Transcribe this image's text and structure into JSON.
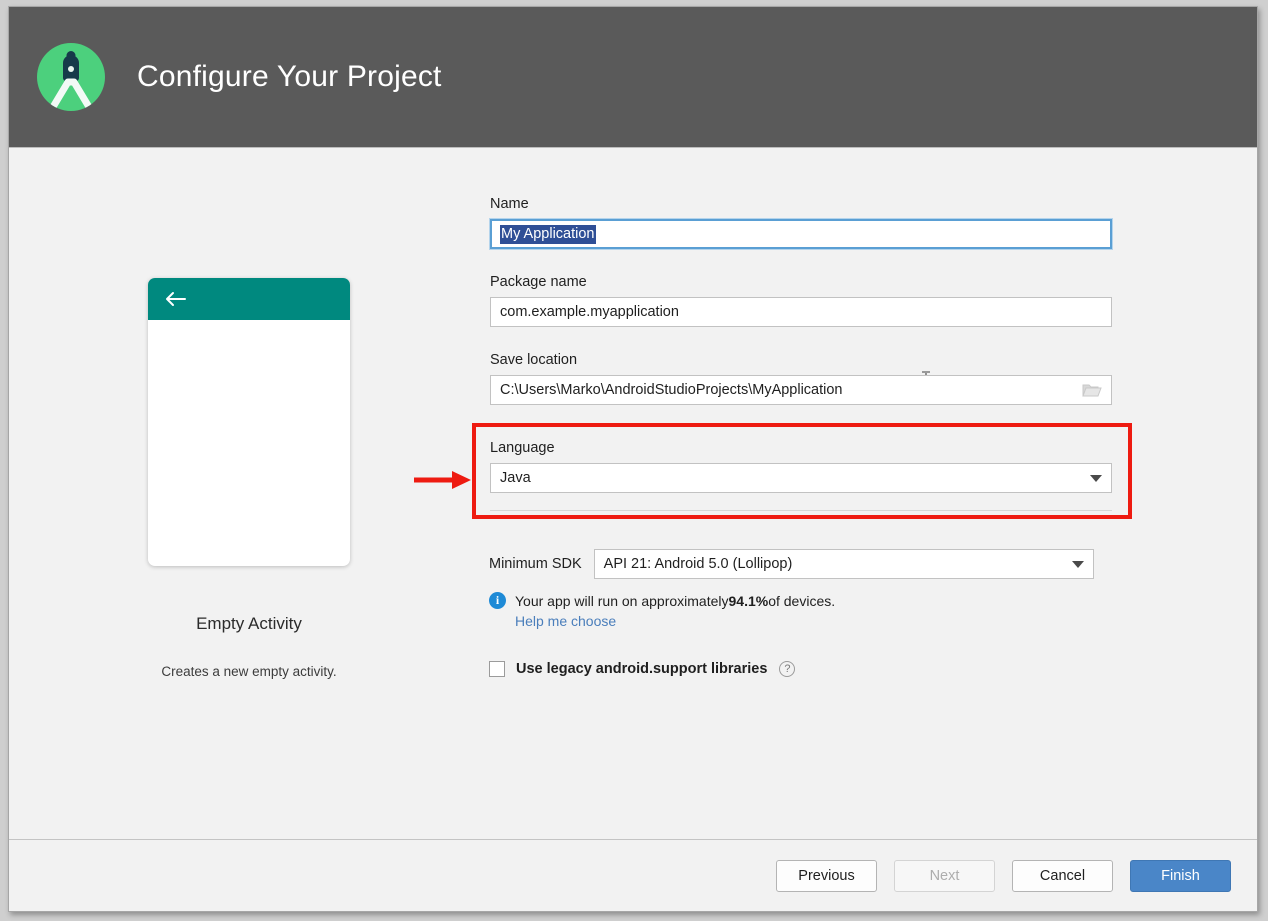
{
  "header": {
    "title": "Configure Your Project",
    "logo_icon": "android-studio-logo-icon"
  },
  "preview": {
    "back_icon": "back-arrow-icon",
    "template_title": "Empty Activity",
    "template_description": "Creates a new empty activity."
  },
  "form": {
    "name": {
      "label": "Name",
      "value": "My Application",
      "selected": true
    },
    "package_name": {
      "label": "Package name",
      "value": "com.example.myapplication"
    },
    "save_location": {
      "label": "Save location",
      "value": "C:\\Users\\Marko\\AndroidStudioProjects\\MyApplication",
      "browse_icon": "folder-open-icon"
    },
    "language": {
      "label": "Language",
      "value": "Java",
      "caret_icon": "chevron-down-icon",
      "highlighted": true
    },
    "minimum_sdk": {
      "label": "Minimum SDK",
      "value": "API 21: Android 5.0 (Lollipop)",
      "caret_icon": "chevron-down-icon"
    },
    "device_info": {
      "info_icon": "info-icon",
      "text_before": "Your app will run on approximately ",
      "percent": "94.1%",
      "text_after": " of devices.",
      "help_link": "Help me choose"
    },
    "legacy_libraries": {
      "label": "Use legacy android.support libraries",
      "checked": false,
      "help_icon": "question-mark-icon"
    }
  },
  "footer": {
    "previous": "Previous",
    "next": "Next",
    "cancel": "Cancel",
    "finish": "Finish"
  },
  "annotations": {
    "highlight_color": "#ee1b11",
    "arrow_icon": "red-arrow-icon",
    "cursor_icon": "text-ibeam-cursor-icon"
  },
  "colors": {
    "header_bg": "#5a5a5a",
    "logo_green": "#4cd07d",
    "appbar_teal": "#00897f",
    "primary_button": "#4a86c8",
    "link": "#4a7ebb",
    "selection": "#2f4f96",
    "annotation_red": "#ee1b11"
  }
}
